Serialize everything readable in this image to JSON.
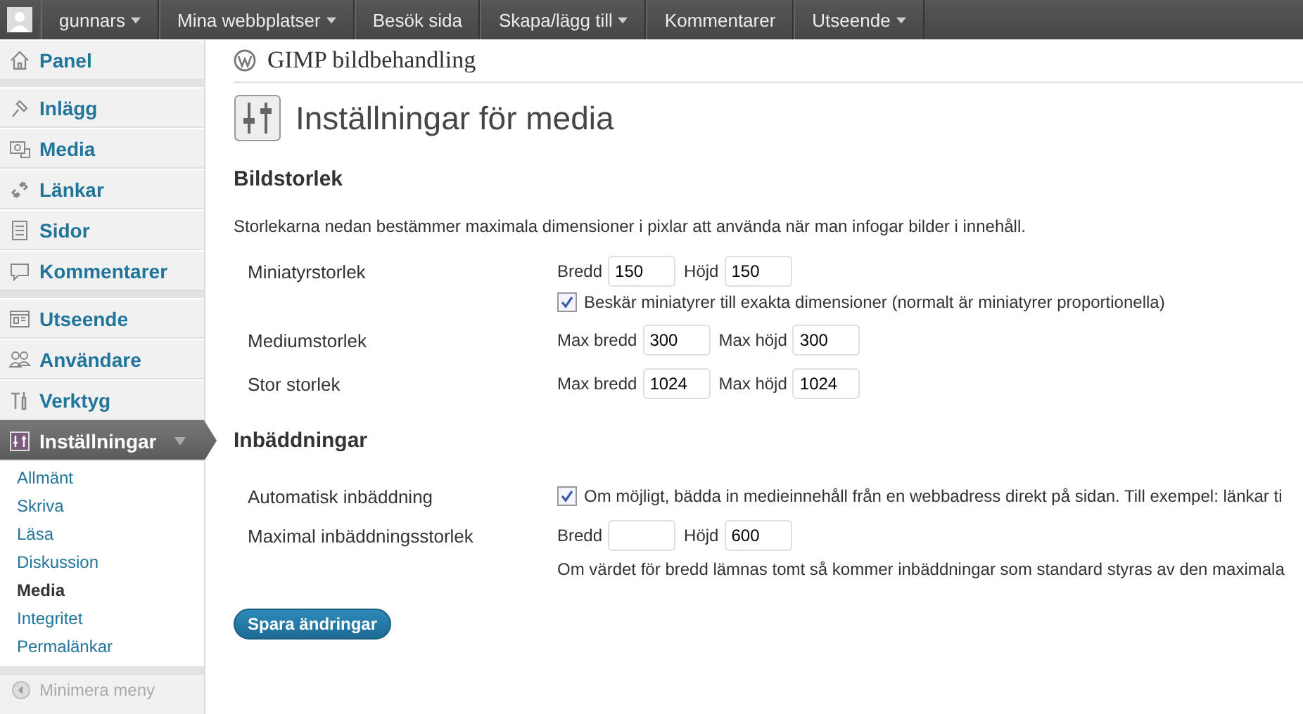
{
  "admin_bar": {
    "items": [
      {
        "label": "gunnars",
        "dropdown": true
      },
      {
        "label": "Mina webbplatser",
        "dropdown": true
      },
      {
        "label": "Besök sida",
        "dropdown": false
      },
      {
        "label": "Skapa/lägg till",
        "dropdown": true
      },
      {
        "label": "Kommentarer",
        "dropdown": false
      },
      {
        "label": "Utseende",
        "dropdown": true
      }
    ]
  },
  "sidebar": {
    "groups": [
      [
        {
          "label": "Panel",
          "selected": false
        }
      ],
      [
        {
          "label": "Inlägg",
          "selected": false
        },
        {
          "label": "Media",
          "selected": false
        },
        {
          "label": "Länkar",
          "selected": false
        },
        {
          "label": "Sidor",
          "selected": false
        },
        {
          "label": "Kommentarer",
          "selected": false
        }
      ],
      [
        {
          "label": "Utseende",
          "selected": false
        },
        {
          "label": "Användare",
          "selected": false
        },
        {
          "label": "Verktyg",
          "selected": false
        },
        {
          "label": "Inställningar",
          "selected": true,
          "children": [
            {
              "label": "Allmänt",
              "selected": false
            },
            {
              "label": "Skriva",
              "selected": false
            },
            {
              "label": "Läsa",
              "selected": false
            },
            {
              "label": "Diskussion",
              "selected": false
            },
            {
              "label": "Media",
              "selected": true
            },
            {
              "label": "Integritet",
              "selected": false
            },
            {
              "label": "Permalänkar",
              "selected": false
            }
          ]
        }
      ]
    ],
    "collapse": "Minimera meny"
  },
  "site_title": "GIMP bildbehandling",
  "page_title": "Inställningar för media",
  "sections": [
    {
      "heading": "Bildstorlek",
      "description": "Storlekarna nedan bestämmer maximala dimensioner i pixlar att använda när man infogar bilder i innehåll.",
      "rows": [
        {
          "label": "Miniatyrstorlek",
          "fields": [
            {
              "label": "Bredd",
              "value": "150"
            },
            {
              "label": "Höjd",
              "value": "150"
            }
          ],
          "checkbox": {
            "checked": true,
            "label": "Beskär miniatyrer till exakta dimensioner (normalt är miniatyrer proportionella)"
          }
        },
        {
          "label": "Mediumstorlek",
          "fields": [
            {
              "label": "Max bredd",
              "value": "300"
            },
            {
              "label": "Max höjd",
              "value": "300"
            }
          ]
        },
        {
          "label": "Stor storlek",
          "fields": [
            {
              "label": "Max bredd",
              "value": "1024"
            },
            {
              "label": "Max höjd",
              "value": "1024"
            }
          ]
        }
      ]
    },
    {
      "heading": "Inbäddningar",
      "rows": [
        {
          "label": "Automatisk inbäddning",
          "checkbox": {
            "checked": true,
            "label": "Om möjligt, bädda in medieinnehåll från en webbadress direkt på sidan. Till exempel: länkar ti"
          }
        },
        {
          "label": "Maximal inbäddningsstorlek",
          "fields": [
            {
              "label": "Bredd"
            },
            {
              "label": "Höjd",
              "value": "600"
            }
          ],
          "note": "Om värdet för bredd lämnas tomt så kommer inbäddningar som standard styras av den maximala"
        }
      ]
    }
  ],
  "save_button": "Spara ändringar"
}
